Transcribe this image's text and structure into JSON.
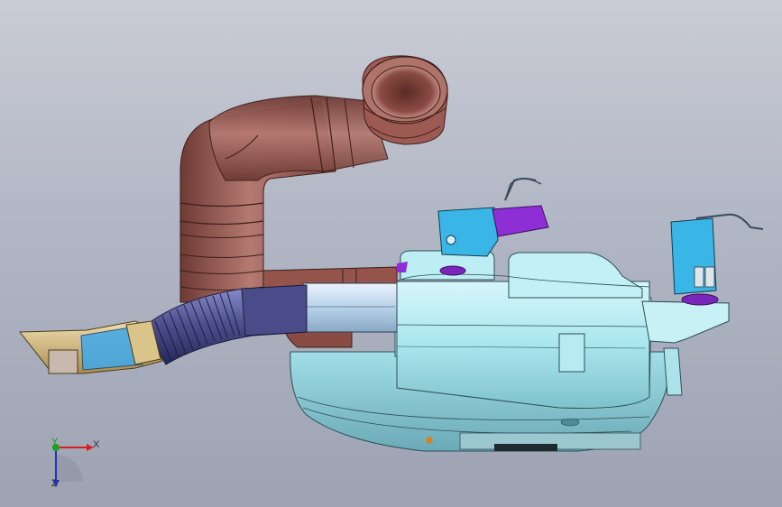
{
  "viewport": {
    "background_top": "#c9ccd6",
    "background_bottom": "#9da3b3"
  },
  "parts": {
    "air_duct_color": "#8a4b44",
    "tank_color": "#a9e6ee",
    "corrugated_hose_color": "#4c4f8c",
    "bracket_color": "#39b6e6",
    "clamp_color": "#8e2fd6",
    "nozzle_color": "#c8b27a"
  },
  "triad": {
    "x_label": "X",
    "y_label": "Y",
    "z_label": "Z",
    "x_color": "#d62020",
    "y_color": "#20a020",
    "z_color": "#2030c8"
  }
}
